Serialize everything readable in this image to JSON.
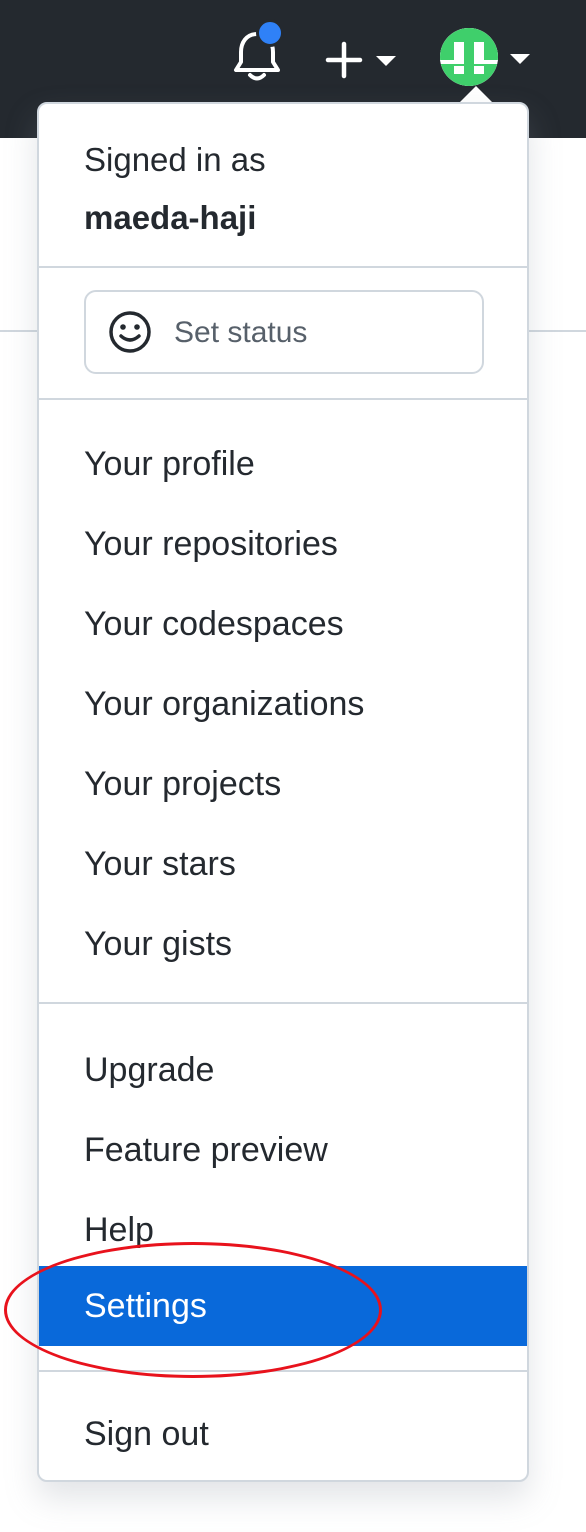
{
  "header": {
    "icons": [
      "bell-icon",
      "plus-icon",
      "chevron-down-icon",
      "avatar"
    ],
    "background_color": "#24292f",
    "notification_dot_color": "#2f81f7",
    "avatar_color": "#3fcf6b"
  },
  "menu": {
    "signed_in_label": "Signed in as",
    "username": "maeda-haji",
    "status_button_label": "Set status",
    "status_icon": "smiley-icon",
    "items": [
      {
        "label": "Your profile"
      },
      {
        "label": "Your repositories"
      },
      {
        "label": "Your codespaces"
      },
      {
        "label": "Your organizations"
      },
      {
        "label": "Your projects"
      },
      {
        "label": "Your stars"
      },
      {
        "label": "Your gists"
      },
      {
        "label": "Upgrade"
      },
      {
        "label": "Feature preview"
      },
      {
        "label": "Help"
      },
      {
        "label": "Settings",
        "highlighted": true
      },
      {
        "label": "Sign out"
      }
    ],
    "highlight_color": "#0969da"
  },
  "annotation": {
    "target": "Settings",
    "color": "#e8121c"
  }
}
